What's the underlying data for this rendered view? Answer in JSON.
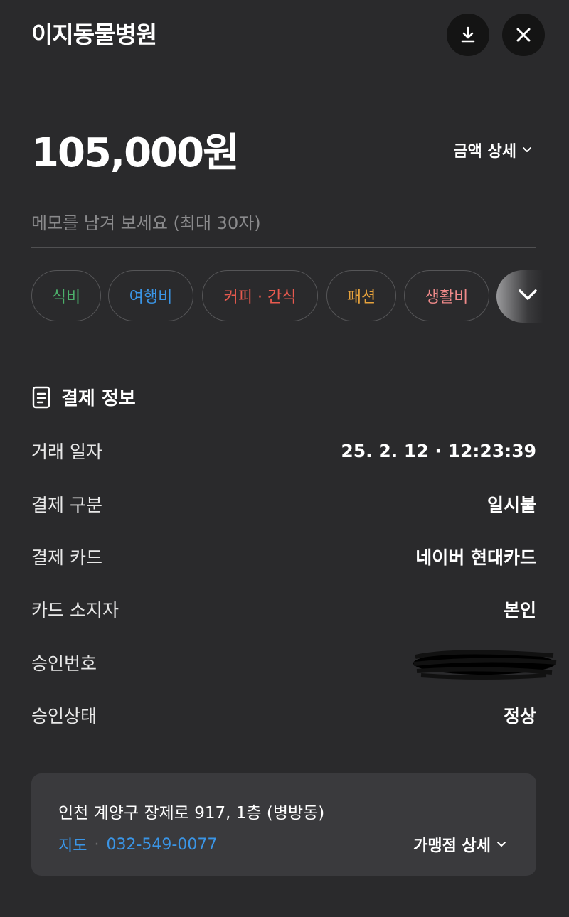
{
  "header": {
    "title": "이지동물병원",
    "download_icon": "download-icon",
    "close_icon": "close-icon"
  },
  "amount": {
    "value": "105,000원",
    "detail_label": "금액 상세"
  },
  "memo": {
    "placeholder": "메모를 남겨 보세요 (최대 30자)"
  },
  "categories": [
    {
      "label": "식비",
      "color": "#4caf6a"
    },
    {
      "label": "여행비",
      "color": "#3a95e6"
    },
    {
      "label": "커피 · 간식",
      "color": "#e85a4f"
    },
    {
      "label": "패션",
      "color": "#e6a23c"
    },
    {
      "label": "생활비",
      "color": "#f08a8a"
    }
  ],
  "payment_info": {
    "title": "결제 정보",
    "rows": [
      {
        "label": "거래 일자",
        "value": "25. 2. 12 · 12:23:39"
      },
      {
        "label": "결제 구분",
        "value": "일시불"
      },
      {
        "label": "결제 카드",
        "value": "네이버 현대카드"
      },
      {
        "label": "카드 소지자",
        "value": "본인"
      },
      {
        "label": "승인번호",
        "value": ""
      },
      {
        "label": "승인상태",
        "value": "정상"
      }
    ]
  },
  "store": {
    "address": "인천 계양구 장제로 917, 1층 (병방동)",
    "map_label": "지도",
    "separator": "·",
    "phone": "032-549-0077",
    "detail_label": "가맹점 상세"
  }
}
